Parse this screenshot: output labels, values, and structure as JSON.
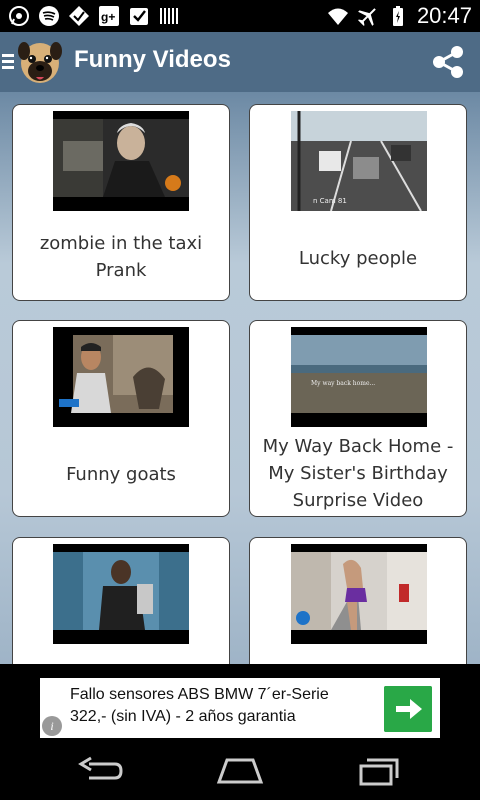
{
  "status_bar": {
    "time": "20:47",
    "left_icons": [
      "whatsapp-icon",
      "spotify-icon",
      "tick-icon",
      "google-plus-icon",
      "checkbox-icon",
      "barcode-icon"
    ],
    "right_icons": [
      "wifi-icon",
      "airplane-icon",
      "battery-icon"
    ]
  },
  "app_bar": {
    "title": "Funny Videos",
    "menu_icon": "hamburger-icon",
    "logo_icon": "pug-logo-icon",
    "share_icon": "share-icon",
    "color": "#4e6b86"
  },
  "videos": [
    {
      "title": "zombie in the taxi Prank"
    },
    {
      "title": "Lucky people"
    },
    {
      "title": "Funny goats",
      "thumb_caption": ""
    },
    {
      "title": "My Way Back Home - My Sister's Birthday Surprise Video",
      "thumb_caption": "My way back home..."
    },
    {
      "title": ""
    },
    {
      "title": ""
    }
  ],
  "ad": {
    "line1": "Fallo sensores ABS BMW 7´er-Serie",
    "line2": "322,- (sin IVA) - 2 años garantia",
    "info_label": "i",
    "go_icon": "arrow-right-icon",
    "go_color": "#29a847"
  },
  "nav": {
    "back_icon": "back-icon",
    "home_icon": "home-icon",
    "recents_icon": "recents-icon"
  }
}
